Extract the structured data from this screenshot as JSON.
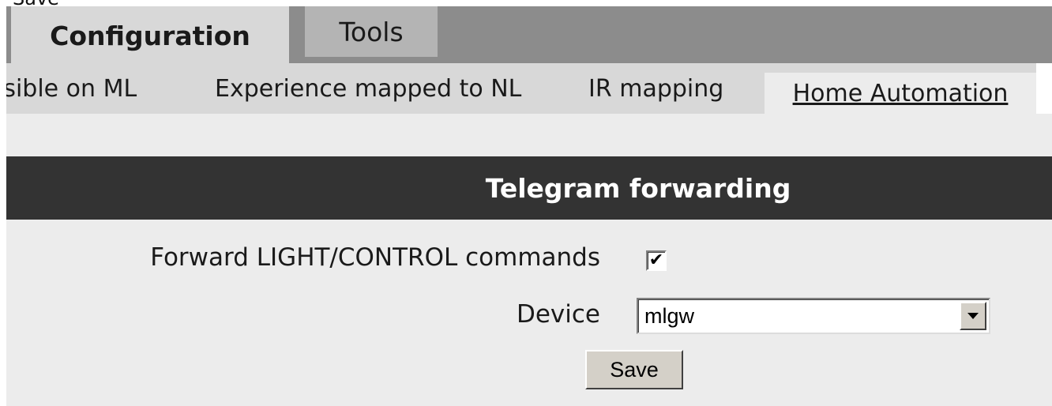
{
  "top_cut_text": "Save",
  "main_tabs": [
    {
      "label": "Configuration",
      "active": true
    },
    {
      "label": "Tools",
      "active": false
    }
  ],
  "sub_tabs": [
    {
      "label": "Visible on ML",
      "visible_text": "isible on ML"
    },
    {
      "label": "Experience mapped to NL"
    },
    {
      "label": "IR mapping"
    },
    {
      "label": "Home Automation",
      "active": true
    }
  ],
  "section": {
    "title": "Telegram forwarding",
    "forward_label": "Forward LIGHT/CONTROL commands",
    "forward_checked": true,
    "device_label": "Device",
    "device_value": "mlgw",
    "save_label": "Save"
  },
  "icons": {
    "checkbox": "checkmark-icon",
    "select": "dropdown-arrow-icon"
  },
  "colors": {
    "tabbar": "#8c8c8c",
    "active_tab": "#d8d8d8",
    "inactive_tab": "#b4b4b4",
    "header_bg": "#333333",
    "content_bg": "#ececec"
  }
}
